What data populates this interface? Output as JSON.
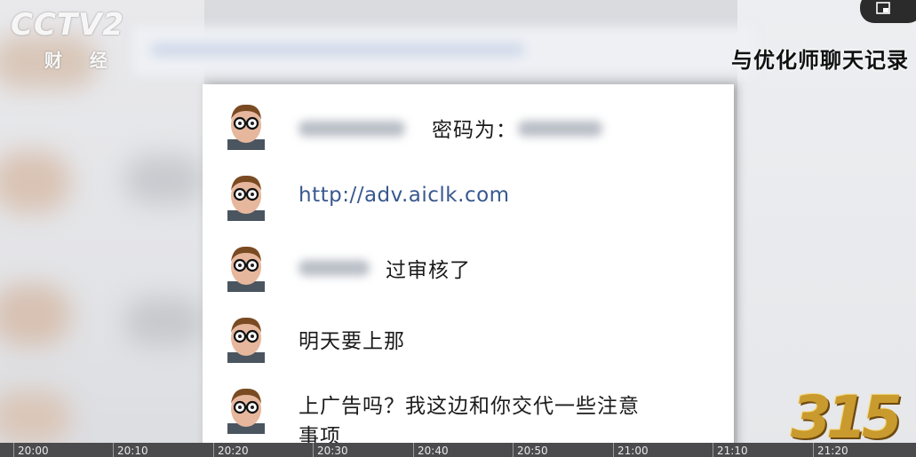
{
  "watermark": {
    "brand": "CCTV2",
    "channel": "财 经"
  },
  "caption": "与优化师聊天记录",
  "badge": "315",
  "messages": [
    {
      "id": "m1",
      "text": "密码为："
    },
    {
      "id": "m2",
      "text": "http://adv.aiclk.com",
      "is_link": true
    },
    {
      "id": "m3",
      "text": "过审核了"
    },
    {
      "id": "m4",
      "text": "明天要上那"
    },
    {
      "id": "m5",
      "text": "上广告吗？我这边和你交代一些注意事项"
    }
  ],
  "timeline": {
    "ticks": [
      "20:00",
      "20:10",
      "20:20",
      "20:30",
      "20:40",
      "20:50",
      "21:00",
      "21:10",
      "21:20"
    ]
  },
  "colors": {
    "link": "#38588f",
    "badge_gold": "#c99a2e",
    "timeline_bg": "#4b4b4e"
  },
  "icons": {
    "corner": "picture-in-picture-icon"
  }
}
